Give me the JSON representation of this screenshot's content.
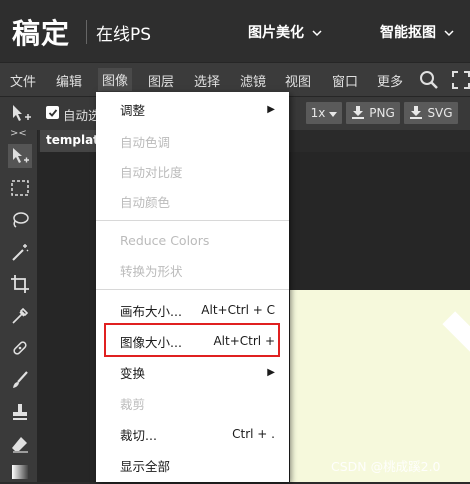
{
  "brand": {
    "logo": "稿定",
    "subtitle": "在线PS"
  },
  "top_nav": [
    {
      "label": "图片美化",
      "chevron": "⌄"
    },
    {
      "label": "智能抠图",
      "chevron": "⌄"
    }
  ],
  "menubar": [
    "文件",
    "编辑",
    "图像",
    "图层",
    "选择",
    "滤镜",
    "视图",
    "窗口",
    "更多"
  ],
  "options": {
    "auto_select_label": "自动选",
    "zoom": "1x",
    "export_png": "PNG",
    "export_svg": "SVG"
  },
  "tab": {
    "name": "templat"
  },
  "image_menu": {
    "items": [
      {
        "label": "调整",
        "shortcut": "",
        "submenu": true,
        "disabled": false
      },
      {
        "label": "自动色调",
        "shortcut": "",
        "submenu": false,
        "disabled": true
      },
      {
        "label": "自动对比度",
        "shortcut": "",
        "submenu": false,
        "disabled": true
      },
      {
        "label": "自动颜色",
        "shortcut": "",
        "submenu": false,
        "disabled": true
      },
      {
        "label": "Reduce Colors",
        "shortcut": "",
        "submenu": false,
        "disabled": true
      },
      {
        "label": "转换为形状",
        "shortcut": "",
        "submenu": false,
        "disabled": true
      },
      {
        "label": "画布大小...",
        "shortcut": "Alt+Ctrl + C",
        "submenu": false,
        "disabled": false
      },
      {
        "label": "图像大小...",
        "shortcut": "Alt+Ctrl +",
        "submenu": false,
        "disabled": false
      },
      {
        "label": "变换",
        "shortcut": "",
        "submenu": true,
        "disabled": false
      },
      {
        "label": "裁剪",
        "shortcut": "",
        "submenu": false,
        "disabled": true
      },
      {
        "label": "裁切...",
        "shortcut": "Ctrl + .",
        "submenu": false,
        "disabled": false
      },
      {
        "label": "显示全部",
        "shortcut": "",
        "submenu": false,
        "disabled": false
      }
    ],
    "submenu_arrow": "▶"
  },
  "watermark": "CSDN @桃成蹊2.0",
  "colors": {
    "highlight": "#e02020",
    "canvas": "#f6f9dc",
    "menubar": "#3b3b3b"
  }
}
